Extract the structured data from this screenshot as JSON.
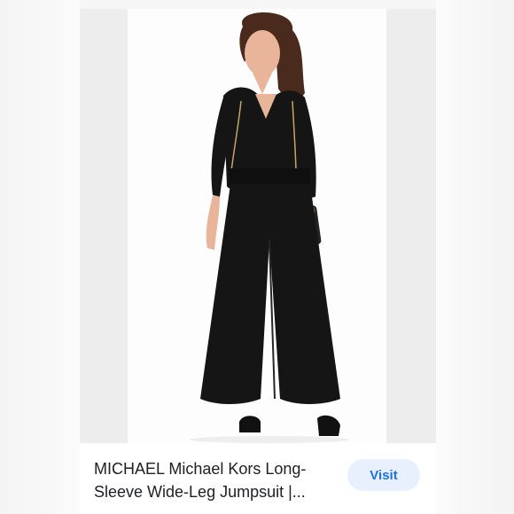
{
  "result": {
    "title": "MICHAEL Michael Kors Long-Sleeve Wide-Leg Jumpsuit |...",
    "visit_label": "Visit",
    "snippet": "...",
    "image_subject": "model-in-black-jumpsuit-photo"
  },
  "colors": {
    "visit_bg": "#e8f0fe",
    "visit_text": "#1a73e8",
    "title_text": "#202124",
    "garment": "#151515"
  }
}
